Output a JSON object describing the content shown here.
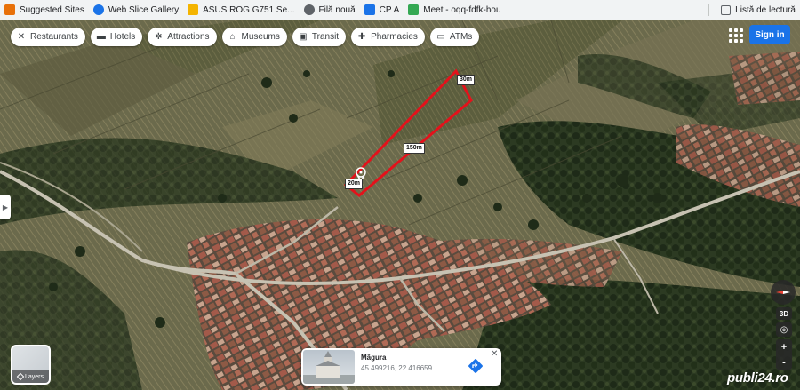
{
  "bookmarks": {
    "items": [
      {
        "label": "Suggested Sites",
        "icon": "bookmark-star-icon",
        "color": "#e8710a"
      },
      {
        "label": "Web Slice Gallery",
        "icon": "globe-icon",
        "color": "#1a73e8"
      },
      {
        "label": "ASUS ROG G751 Se...",
        "icon": "folder-icon",
        "color": "#f4b400"
      },
      {
        "label": "Filă nouă",
        "icon": "globe-icon",
        "color": "#5f6368"
      },
      {
        "label": "CP A",
        "icon": "document-icon",
        "color": "#1a73e8"
      },
      {
        "label": "Meet - oqq-fdfk-hou",
        "icon": "meet-icon",
        "color": "#34a853"
      }
    ],
    "reading_list": "Listă de lectură"
  },
  "map": {
    "categories": [
      {
        "label": "Restaurants",
        "icon": "restaurant-icon"
      },
      {
        "label": "Hotels",
        "icon": "hotel-icon"
      },
      {
        "label": "Attractions",
        "icon": "attraction-icon"
      },
      {
        "label": "Museums",
        "icon": "museum-icon"
      },
      {
        "label": "Transit",
        "icon": "transit-icon"
      },
      {
        "label": "Pharmacies",
        "icon": "pharmacy-icon"
      },
      {
        "label": "ATMs",
        "icon": "atm-icon"
      }
    ],
    "signin_label": "Sign in",
    "layers_label": "Layers",
    "measurements": {
      "top": "30m",
      "long_side": "150m",
      "short_side": "20m"
    },
    "place": {
      "name": "Măgura",
      "coords": "45.499216, 22.416659"
    },
    "controls": {
      "three_d": "3D",
      "zoom_in": "+",
      "zoom_out": "-"
    },
    "watermark": "publi24.ro",
    "colors": {
      "plot_outline": "#e3121b",
      "signin": "#1a73e8",
      "accent_road": "#c7c2b2"
    }
  }
}
